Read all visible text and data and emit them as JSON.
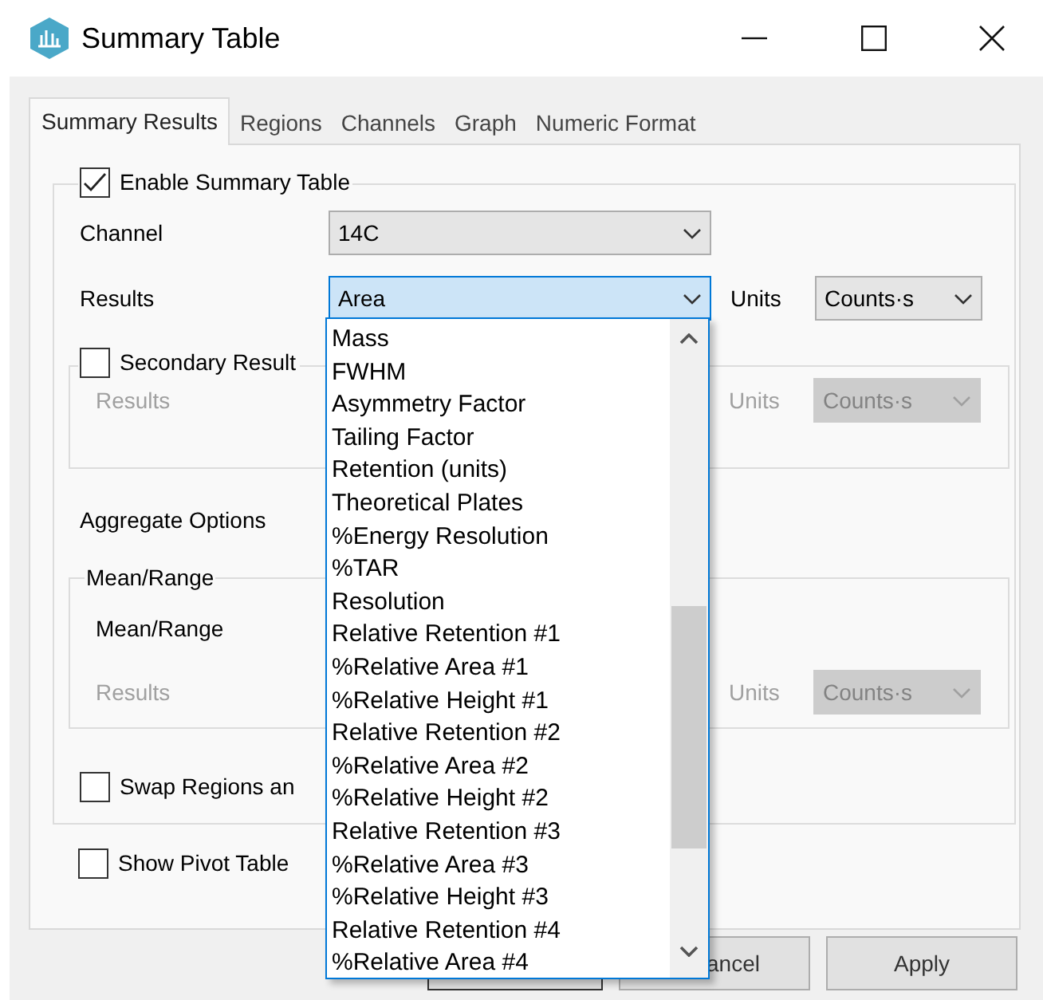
{
  "window": {
    "title": "Summary Table"
  },
  "tabs": [
    {
      "label": "Summary Results",
      "selected": true
    },
    {
      "label": "Regions",
      "selected": false
    },
    {
      "label": "Channels",
      "selected": false
    },
    {
      "label": "Graph",
      "selected": false
    },
    {
      "label": "Numeric Format",
      "selected": false
    }
  ],
  "enable_summary_table": {
    "label": "Enable Summary Table",
    "checked": true
  },
  "channel": {
    "label": "Channel",
    "value": "14C"
  },
  "results": {
    "label": "Results",
    "value": "Area",
    "units_label": "Units",
    "units_value": "Counts·s"
  },
  "secondary_results": {
    "label": "Secondary Result",
    "checked": false,
    "disabled": true,
    "results_label": "Results",
    "units_label": "Units",
    "units_value": "Counts·s"
  },
  "aggregate_options": {
    "label": "Aggregate Options"
  },
  "mean_range": {
    "group_label": "Mean/Range",
    "label": "Mean/Range",
    "disabled": true,
    "results_label": "Results",
    "units_label": "Units",
    "units_value": "Counts·s"
  },
  "swap_regions": {
    "label": "Swap Regions an",
    "checked": false
  },
  "show_pivot_table": {
    "label": "Show Pivot Table",
    "checked": false
  },
  "dropdown_list": {
    "items": [
      {
        "label": "Mass"
      },
      {
        "label": "FWHM"
      },
      {
        "label": "Asymmetry Factor"
      },
      {
        "label": "Tailing Factor"
      },
      {
        "label": "Retention (units)"
      },
      {
        "label": "Theoretical Plates"
      },
      {
        "label": "%Energy Resolution"
      },
      {
        "label": "%TAR"
      },
      {
        "label": "Resolution"
      },
      {
        "label": "Relative Retention #1"
      },
      {
        "label": "%Relative Area #1"
      },
      {
        "label": "%Relative Height #1"
      },
      {
        "label": "Relative Retention #2"
      },
      {
        "label": "%Relative Area #2"
      },
      {
        "label": "%Relative Height #2"
      },
      {
        "label": "Relative Retention #3"
      },
      {
        "label": "%Relative Area #3"
      },
      {
        "label": "%Relative Height #3"
      },
      {
        "label": "Relative Retention #4"
      },
      {
        "label": "%Relative Area #4"
      }
    ]
  },
  "buttons": [
    {
      "kind": "covered"
    },
    {
      "kind": "text",
      "label": "ancel"
    },
    {
      "kind": "text",
      "label": "Apply"
    }
  ]
}
